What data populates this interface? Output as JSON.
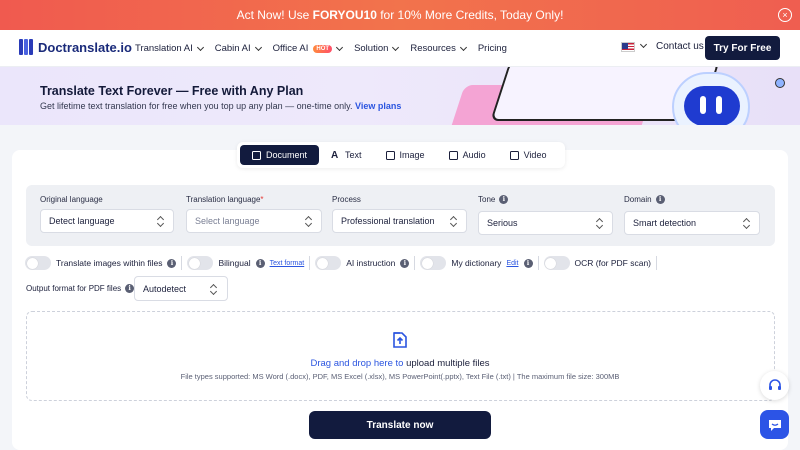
{
  "promo": {
    "prefix": "Act Now! Use ",
    "code": "FORYOU10",
    "suffix": " for 10% More Credits, Today Only!",
    "close_glyph": "×"
  },
  "nav": {
    "brand": "Doctranslate.io",
    "items": [
      "Translation AI",
      "Cabin AI",
      "Office AI",
      "Solution",
      "Resources",
      "Pricing"
    ],
    "office_badge": "HOT",
    "contact": "Contact us",
    "cta": "Try For Free"
  },
  "hero": {
    "title": "Translate Text Forever — Free with Any Plan",
    "subtitle": "Get lifetime text translation for free when you top up any plan — one-time only. ",
    "link": "View plans"
  },
  "tabs": [
    "Document",
    "Text",
    "Image",
    "Audio",
    "Video"
  ],
  "options": {
    "original": {
      "label": "Original language",
      "value": "Detect language"
    },
    "translation": {
      "label": "Translation language",
      "required": "*",
      "placeholder": "Select language"
    },
    "process": {
      "label": "Process",
      "value": "Professional translation"
    },
    "tone": {
      "label": "Tone",
      "value": "Serious"
    },
    "domain": {
      "label": "Domain",
      "value": "Smart detection"
    }
  },
  "toggles": {
    "images": "Translate images within files",
    "bilingual": "Bilingual",
    "text_format": "Text format",
    "ai": "AI instruction",
    "dictionary": "My dictionary",
    "edit": "Edit",
    "ocr": "OCR (for PDF scan)"
  },
  "pdf": {
    "label": "Output format for PDF files",
    "value": "Autodetect"
  },
  "drop": {
    "highlight": "Drag and drop here to",
    "rest": " upload multiple files",
    "types": "File types supported: MS Word (.docx), PDF, MS Excel (.xlsx), MS PowerPoint(.pptx), Text File (.txt) | The maximum file size: 300MB"
  },
  "translate_button": "Translate now",
  "info_glyph": "i"
}
